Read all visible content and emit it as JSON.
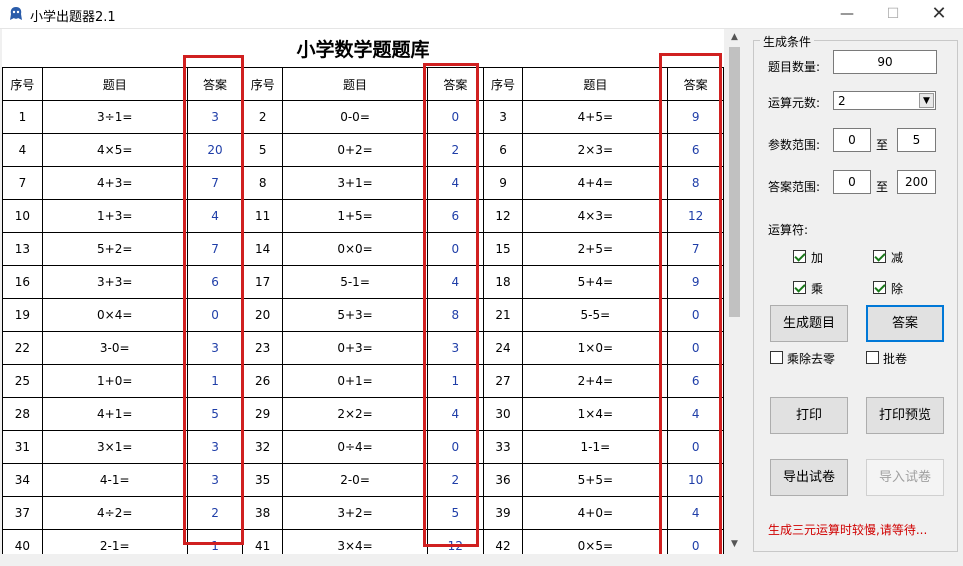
{
  "window": {
    "title": "小学出题器2.1",
    "minimize": "—",
    "maximize": "☐",
    "close": "✕"
  },
  "sheet": {
    "title": "小学数学题题库",
    "headers": [
      "序号",
      "题目",
      "答案"
    ],
    "rows": [
      [
        [
          1,
          "3÷1=",
          3
        ],
        [
          2,
          "0-0=",
          0
        ],
        [
          3,
          "4+5=",
          9
        ]
      ],
      [
        [
          4,
          "4×5=",
          20
        ],
        [
          5,
          "0+2=",
          2
        ],
        [
          6,
          "2×3=",
          6
        ]
      ],
      [
        [
          7,
          "4+3=",
          7
        ],
        [
          8,
          "3+1=",
          4
        ],
        [
          9,
          "4+4=",
          8
        ]
      ],
      [
        [
          10,
          "1+3=",
          4
        ],
        [
          11,
          "1+5=",
          6
        ],
        [
          12,
          "4×3=",
          12
        ]
      ],
      [
        [
          13,
          "5+2=",
          7
        ],
        [
          14,
          "0×0=",
          0
        ],
        [
          15,
          "2+5=",
          7
        ]
      ],
      [
        [
          16,
          "3+3=",
          6
        ],
        [
          17,
          "5-1=",
          4
        ],
        [
          18,
          "5+4=",
          9
        ]
      ],
      [
        [
          19,
          "0×4=",
          0
        ],
        [
          20,
          "5+3=",
          8
        ],
        [
          21,
          "5-5=",
          0
        ]
      ],
      [
        [
          22,
          "3-0=",
          3
        ],
        [
          23,
          "0+3=",
          3
        ],
        [
          24,
          "1×0=",
          0
        ]
      ],
      [
        [
          25,
          "1+0=",
          1
        ],
        [
          26,
          "0+1=",
          1
        ],
        [
          27,
          "2+4=",
          6
        ]
      ],
      [
        [
          28,
          "4+1=",
          5
        ],
        [
          29,
          "2×2=",
          4
        ],
        [
          30,
          "1×4=",
          4
        ]
      ],
      [
        [
          31,
          "3×1=",
          3
        ],
        [
          32,
          "0÷4=",
          0
        ],
        [
          33,
          "1-1=",
          0
        ]
      ],
      [
        [
          34,
          "4-1=",
          3
        ],
        [
          35,
          "2-0=",
          2
        ],
        [
          36,
          "5+5=",
          10
        ]
      ],
      [
        [
          37,
          "4÷2=",
          2
        ],
        [
          38,
          "3+2=",
          5
        ],
        [
          39,
          "4+0=",
          4
        ]
      ],
      [
        [
          40,
          "2-1=",
          1
        ],
        [
          41,
          "3×4=",
          12
        ],
        [
          42,
          "0×5=",
          0
        ]
      ]
    ]
  },
  "panel": {
    "group_title": "生成条件",
    "count_label": "题目数量:",
    "count_value": "90",
    "operands_label": "运算元数:",
    "operands_value": "2",
    "param_label": "参数范围:",
    "param_min": "0",
    "param_to": "至",
    "param_max": "5",
    "answer_label": "答案范围:",
    "answer_min": "0",
    "answer_to": "至",
    "answer_max": "200",
    "ops_label": "运算符:",
    "op_add": "加",
    "op_sub": "减",
    "op_mul": "乘",
    "op_div": "除",
    "generate_btn": "生成题目",
    "answer_btn": "答案",
    "no_zero_label": "乘除去零",
    "grade_label": "批卷",
    "print_btn": "打印",
    "preview_btn": "打印预览",
    "export_btn": "导出试卷",
    "import_btn": "导入试卷",
    "status": "生成三元运算时较慢,请等待..."
  }
}
